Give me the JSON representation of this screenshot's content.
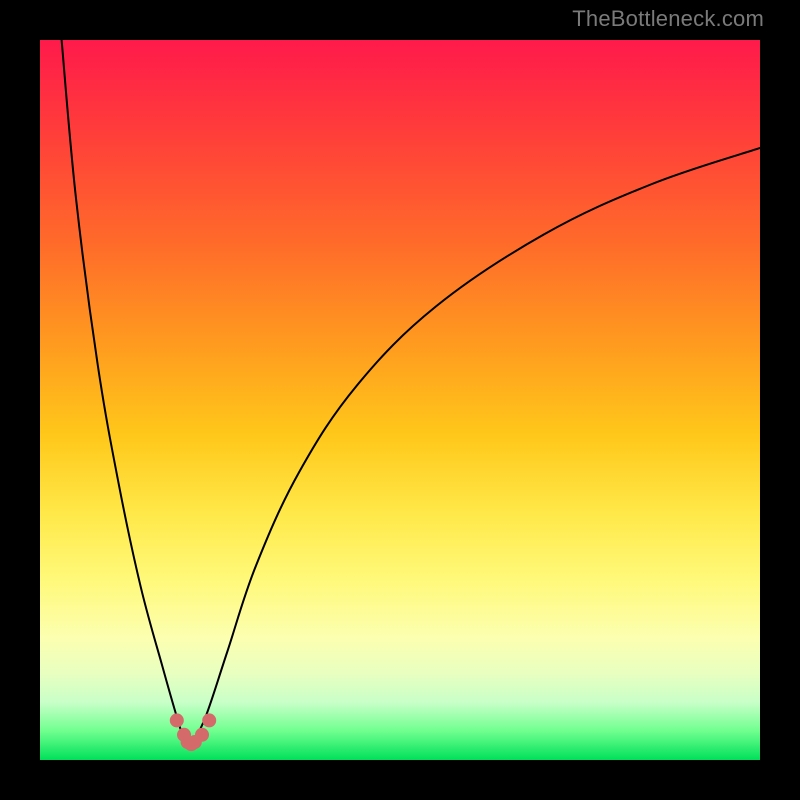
{
  "watermark": "TheBottleneck.com",
  "chart_data": {
    "type": "line",
    "title": "",
    "xlabel": "",
    "ylabel": "",
    "xlim": [
      0,
      100
    ],
    "ylim": [
      0,
      100
    ],
    "notes": "Two curves forming a V shape, both meeting near (x≈21, y≈3). Left branch rises steeply to y≈100 at x≈3. Right branch rises with decreasing slope toward y≈85 at x≈100. Background is a vertical color gradient from red (top / high y) to green (bottom / low y).",
    "series": [
      {
        "name": "left-branch",
        "x": [
          3,
          5,
          8,
          11,
          14,
          17,
          19,
          20,
          21
        ],
        "y": [
          100,
          78,
          55,
          38,
          24,
          13,
          6,
          3,
          2
        ]
      },
      {
        "name": "right-branch",
        "x": [
          21,
          23,
          26,
          30,
          36,
          44,
          55,
          70,
          85,
          100
        ],
        "y": [
          2,
          6,
          15,
          27,
          40,
          52,
          63,
          73,
          80,
          85
        ]
      }
    ],
    "markers": {
      "name": "bottom-cluster",
      "color": "#d46a6a",
      "points_xy": [
        [
          19,
          5.5
        ],
        [
          20,
          3.5
        ],
        [
          20.5,
          2.5
        ],
        [
          21,
          2.2
        ],
        [
          21.5,
          2.5
        ],
        [
          22.5,
          3.5
        ],
        [
          23.5,
          5.5
        ]
      ]
    },
    "gradient_stops": [
      {
        "pct": 0,
        "color": "#ff1a4b"
      },
      {
        "pct": 12,
        "color": "#ff3b3b"
      },
      {
        "pct": 28,
        "color": "#ff6a2a"
      },
      {
        "pct": 42,
        "color": "#ff9a1f"
      },
      {
        "pct": 55,
        "color": "#ffc81a"
      },
      {
        "pct": 66,
        "color": "#ffe94a"
      },
      {
        "pct": 75,
        "color": "#fff97a"
      },
      {
        "pct": 83,
        "color": "#fcffb0"
      },
      {
        "pct": 88,
        "color": "#e8ffc0"
      },
      {
        "pct": 92,
        "color": "#c8ffc8"
      },
      {
        "pct": 96,
        "color": "#6fff8f"
      },
      {
        "pct": 100,
        "color": "#00e05a"
      }
    ]
  }
}
